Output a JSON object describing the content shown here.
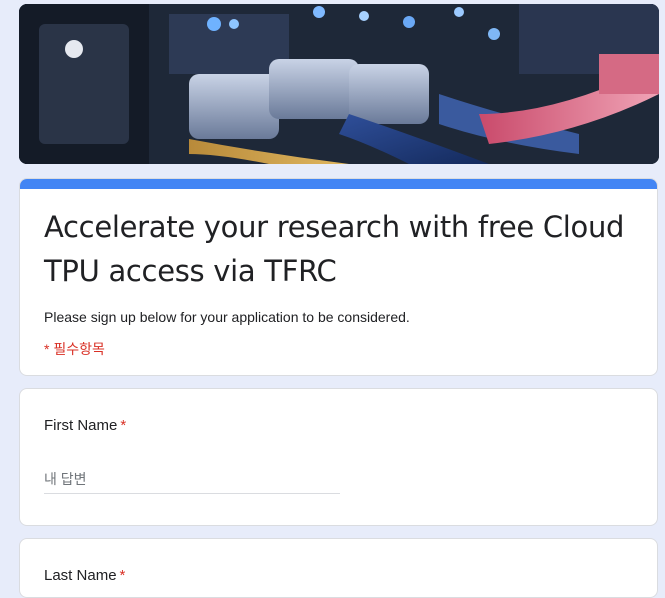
{
  "form": {
    "title": "Accelerate your research with free Cloud TPU access via TFRC",
    "description": "Please sign up below for your application to be considered.",
    "required_note": "* 필수항목"
  },
  "questions": [
    {
      "label": "First Name",
      "required_mark": "*",
      "placeholder": "내 답변"
    },
    {
      "label": "Last Name",
      "required_mark": "*"
    }
  ],
  "colors": {
    "accent": "#4285f4",
    "required": "#d93025",
    "background": "#e7ecfa"
  }
}
